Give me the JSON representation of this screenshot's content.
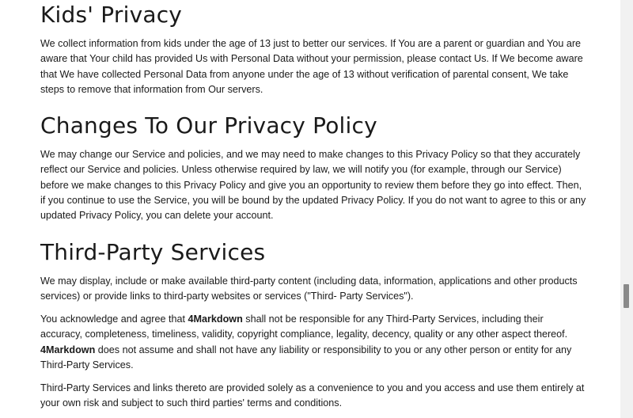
{
  "sections": {
    "kids": {
      "title": "Kids' Privacy",
      "p1": "We collect information from kids under the age of 13 just to better our services. If You are a parent or guardian and You are aware that Your child has provided Us with Personal Data without your permission, please contact Us. If We become aware that We have collected Personal Data from anyone under the age of 13 without verification of parental consent, We take steps to remove that information from Our servers."
    },
    "changes": {
      "title": "Changes To Our Privacy Policy",
      "p1": "We may change our Service and policies, and we may need to make changes to this Privacy Policy so that they accurately reflect our Service and policies. Unless otherwise required by law, we will notify you (for example, through our Service) before we make changes to this Privacy Policy and give you an opportunity to review them before they go into effect. Then, if you continue to use the Service, you will be bound by the updated Privacy Policy. If you do not want to agree to this or any updated Privacy Policy, you can delete your account."
    },
    "third_party": {
      "title": "Third-Party Services",
      "p1": "We may display, include or make available third-party content (including data, information, applications and other products services) or provide links to third-party websites or services (\"Third- Party Services\").",
      "p2_a": "You acknowledge and agree that ",
      "brand": "4Markdown",
      "p2_b": " shall not be responsible for any Third-Party Services, including their accuracy, completeness, timeliness, validity, copyright compliance, legality, decency, quality or any other aspect thereof. ",
      "p2_c": " does not assume and shall not have any liability or responsibility to you or any other person or entity for any Third-Party Services.",
      "p3": "Third-Party Services and links thereto are provided solely as a convenience to you and you access and use them entirely at your own risk and subject to such third parties' terms and conditions."
    }
  },
  "scrollbar": {
    "position": 0.72
  }
}
